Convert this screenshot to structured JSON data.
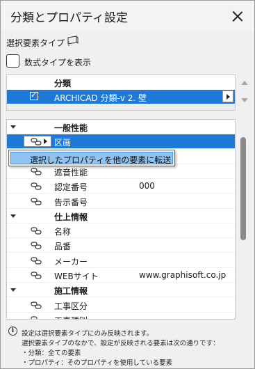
{
  "window": {
    "title": "分類とプロパティ設定"
  },
  "selection": {
    "label": "選択要素タイプ :",
    "icon": "wall-type-icon"
  },
  "formula_checkbox": {
    "label": "数式タイプを表示",
    "checked": false
  },
  "classification": {
    "header": "分類",
    "row": {
      "checked": true,
      "text": "ARCHICAD 分類-v 2. 壁"
    }
  },
  "tree": {
    "rows": [
      {
        "type": "group",
        "label": "一般性能"
      },
      {
        "type": "item",
        "label": "区画",
        "value": "",
        "selected": true
      },
      {
        "type": "item",
        "label": "",
        "value": ""
      },
      {
        "type": "item",
        "label": "遮音性能",
        "value": ""
      },
      {
        "type": "item",
        "label": "認定番号",
        "value": "000"
      },
      {
        "type": "item",
        "label": "告示番号",
        "value": ""
      },
      {
        "type": "group",
        "label": "仕上情報"
      },
      {
        "type": "item",
        "label": "名称",
        "value": ""
      },
      {
        "type": "item",
        "label": "品番",
        "value": ""
      },
      {
        "type": "item",
        "label": "メーカー",
        "value": ""
      },
      {
        "type": "item",
        "label": "WEBサイト",
        "value": "www.graphisoft.co.jp"
      },
      {
        "type": "group",
        "label": "施工情報"
      },
      {
        "type": "item",
        "label": "工事区分",
        "value": ""
      },
      {
        "type": "item",
        "label": "工事種別",
        "value": ""
      }
    ]
  },
  "context_menu": {
    "item": "選択したプロパティを他の要素に転送"
  },
  "info": {
    "lines": [
      "設定は選択要素タイプにのみ反映されます。",
      "選択要素タイプのなかで、設定が反映される要素は次の通りです：",
      "・分類：全ての要素",
      "・プロパティ：そのプロパティを使用している要素"
    ]
  }
}
